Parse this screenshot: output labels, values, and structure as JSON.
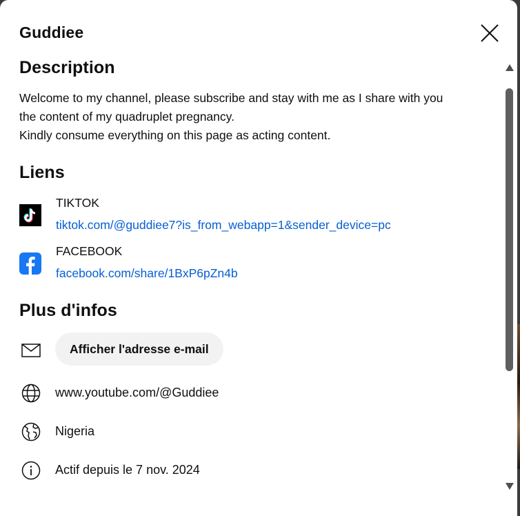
{
  "dialog": {
    "title": "Guddiee",
    "close_icon": "close-icon"
  },
  "description": {
    "heading": "Description",
    "line1": "Welcome to my channel, please subscribe and stay with me as I share with you",
    "line2": "the content of my quadruplet pregnancy.",
    "line3": "Kindly consume everything on this page as acting content."
  },
  "links": {
    "heading": "Liens",
    "items": [
      {
        "title": "TIKTOK",
        "url": "tiktok.com/@guddiee7?is_from_webapp=1&sender_device=pc",
        "icon": "tiktok-logo-icon"
      },
      {
        "title": "FACEBOOK",
        "url": "facebook.com/share/1BxP6pZn4b",
        "icon": "facebook-logo-icon"
      }
    ]
  },
  "more_info": {
    "heading": "Plus d'infos",
    "email_button": "Afficher l'adresse e-mail",
    "channel_url": "www.youtube.com/@Guddiee",
    "country": "Nigeria",
    "joined": "Actif depuis le 7 nov. 2024"
  },
  "colors": {
    "link": "#065fd4",
    "facebook": "#1877f2",
    "button_bg": "#f2f2f2"
  }
}
